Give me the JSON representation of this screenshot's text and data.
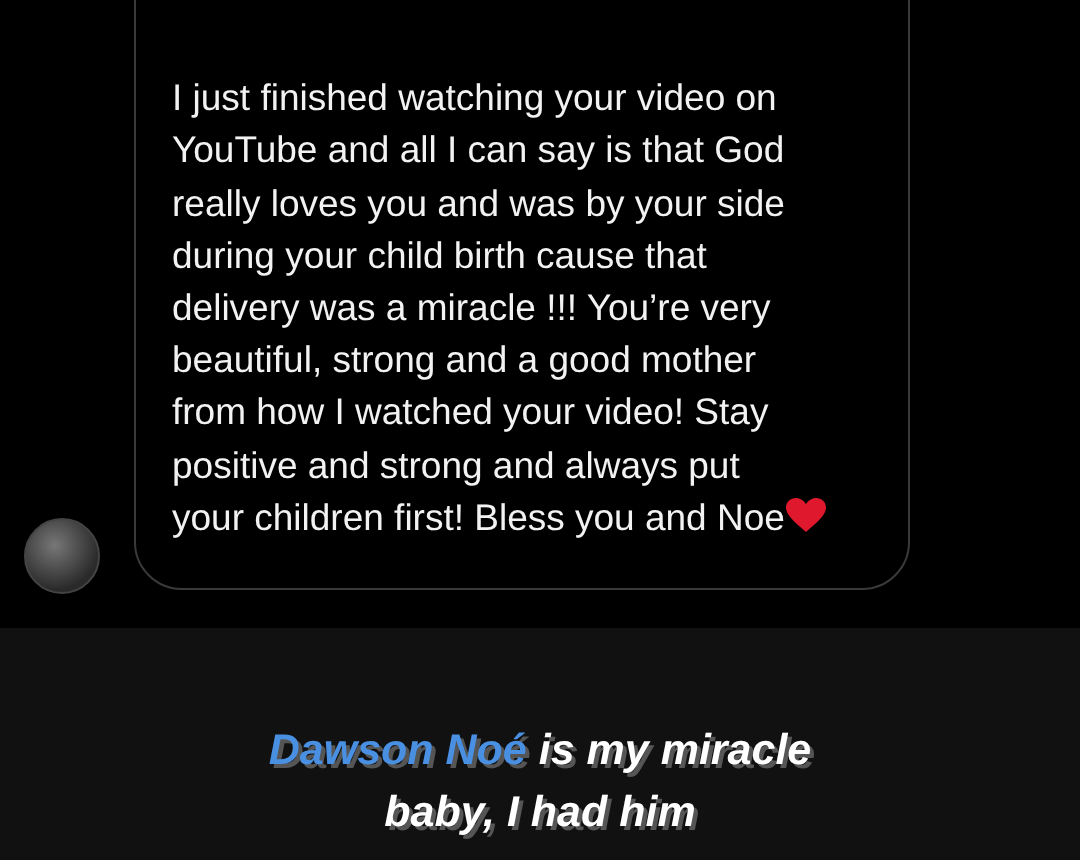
{
  "message": {
    "text": "I just finished watching your video on YouTube and all I can say is that God really loves you and was by your side during your child birth cause that delivery was a miracle !!! You’re very beautiful, strong and a good mother from how I watched your video! Stay positive and strong and always put your children first! Bless you and Noe"
  },
  "caption": {
    "highlight": "Dawson Noé",
    "text": "is my miracle baby, I had him"
  }
}
